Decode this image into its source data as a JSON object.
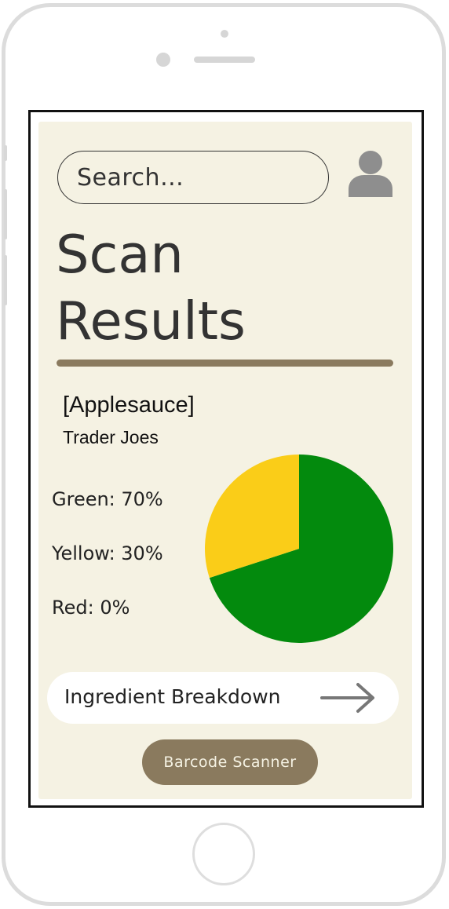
{
  "search": {
    "placeholder": "Search..."
  },
  "header": {
    "title_line1": "Scan",
    "title_line2": "Results"
  },
  "product": {
    "name": "[Applesauce]",
    "brand": "Trader Joes"
  },
  "stats": [
    {
      "label": "Green: 70%",
      "value": 70,
      "color": "#038a0d"
    },
    {
      "label": "Yellow: 30%",
      "value": 30,
      "color": "#facd18"
    },
    {
      "label": "Red: 0%",
      "value": 0,
      "color": "#d32f2f"
    }
  ],
  "actions": {
    "breakdown_label": "Ingredient Breakdown",
    "barcode_label": "Barcode Scanner"
  },
  "colors": {
    "background": "#f5f2e3",
    "accent": "#8a7a5e",
    "green": "#038a0d",
    "yellow": "#facd18",
    "text": "#333333"
  },
  "icons": {
    "profile": "user-avatar-icon",
    "arrow": "arrow-right-icon"
  }
}
